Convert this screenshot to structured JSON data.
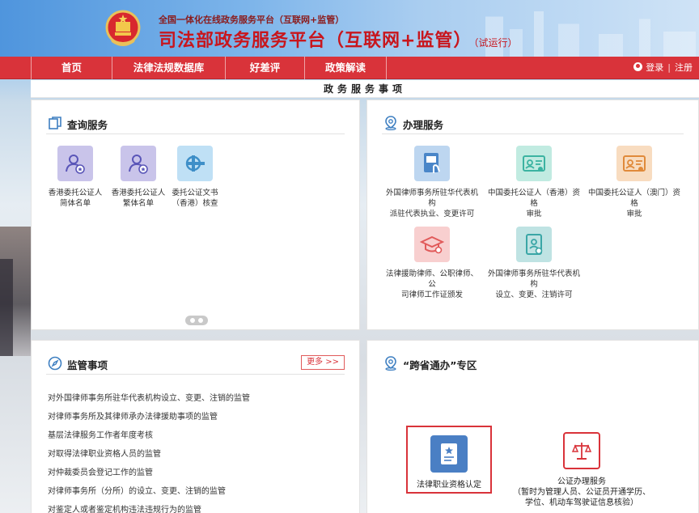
{
  "header": {
    "subtitle": "全国一体化在线政务服务平台（互联网+监管）",
    "title": "司法部政务服务平台（互联网+监管）",
    "trial": "（试运行）"
  },
  "nav": {
    "items": [
      "首页",
      "法律法规数据库",
      "好差评",
      "政策解读"
    ],
    "login": "登录",
    "separator": "|",
    "register": "注册"
  },
  "section_title": "政务服务事项",
  "query_panel": {
    "title": "查询服务",
    "icon": "copy-icon",
    "items": [
      {
        "line1": "香港委托公证人",
        "line2": "简体名单",
        "icon": "person-badge-icon"
      },
      {
        "line1": "香港委托公证人",
        "line2": "繁体名单",
        "icon": "person-badge-icon"
      },
      {
        "line1": "委托公证文书",
        "line2": "（香港）核查",
        "icon": "seal-icon"
      }
    ]
  },
  "handle_panel": {
    "title": "办理服务",
    "icon": "location-pin-icon",
    "items": [
      {
        "line1": "外国律师事务所驻华代表机构",
        "line2": "派驻代表执业、变更许可",
        "color": "#4a86c8",
        "icon": "document-touch-icon"
      },
      {
        "line1": "中国委托公证人（香港）资格",
        "line2": "审批",
        "color": "#3bb3a1",
        "icon": "id-card-icon"
      },
      {
        "line1": "中国委托公证人（澳门）资格",
        "line2": "审批",
        "color": "#e59a4d",
        "icon": "id-card-icon"
      },
      {
        "line1": "法律援助律师、公职律师、公",
        "line2": "司律师工作证颁发",
        "color": "#e15a5a",
        "icon": "graduation-cap-icon"
      },
      {
        "line1": "外国律师事务所驻华代表机构",
        "line2": "设立、变更、注销许可",
        "color": "#3aa6a6",
        "icon": "document-icon"
      }
    ]
  },
  "supervise_panel": {
    "title": "监管事项",
    "icon": "compass-icon",
    "more": "更多 >>",
    "items": [
      "对外国律师事务所驻华代表机构设立、变更、注销的监管",
      "对律师事务所及其律师承办法律援助事项的监管",
      "基层法律服务工作者年度考核",
      "对取得法律职业资格人员的监管",
      "对仲裁委员会登记工作的监管",
      "对律师事务所（分所）的设立、变更、注销的监管",
      "对鉴定人或者鉴定机构违法违规行为的监管"
    ]
  },
  "cross_panel": {
    "title": "“跨省通办”专区",
    "icon": "location-pin-icon",
    "items": [
      {
        "lines": [
          "法律职业资格认定"
        ],
        "color": "#4a7fc4",
        "icon": "certificate-icon",
        "selected": true
      },
      {
        "lines": [
          "公证办理服务",
          "（暂时为管理人员、公证员开通学历、",
          "学位、机动车驾驶证信息核验）"
        ],
        "color": "#d9333a",
        "icon": "scales-icon",
        "selected": false
      }
    ]
  },
  "colors": {
    "nav_red": "#d9333a",
    "title_red": "#c8161d",
    "selected_border": "#d9333a"
  }
}
